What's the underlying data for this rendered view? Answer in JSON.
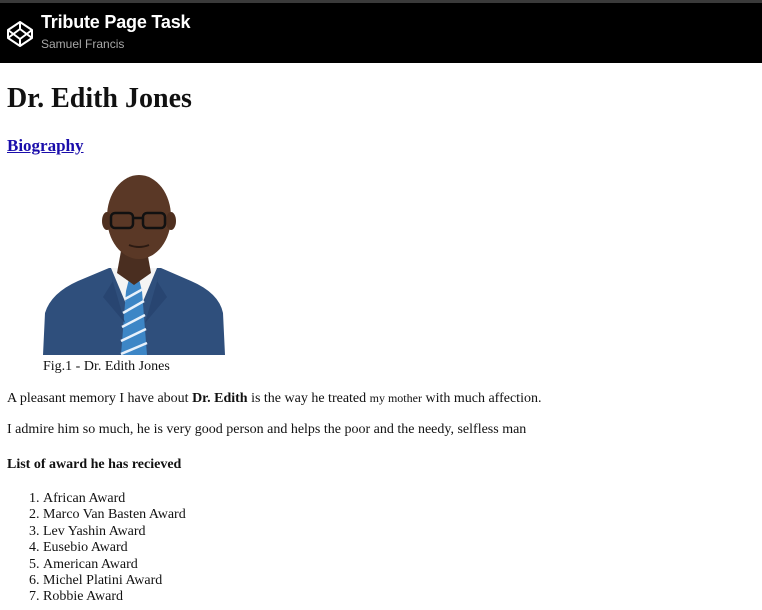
{
  "header": {
    "title": "Tribute Page Task",
    "author": "Samuel Francis",
    "logo_icon": "codepen-icon"
  },
  "page": {
    "heading": "Dr. Edith Jones",
    "biography_link": "Biography",
    "figure_caption": "Fig.1 - Dr. Edith Jones",
    "p1": {
      "pre": "A pleasant memory I have about ",
      "bold": "Dr. Edith",
      "mid": " is the way he treated ",
      "small": "my mother",
      "post": " with much affection."
    },
    "p2": "I admire him so much, he is very good person and helps the poor and the needy, selfless man",
    "awards_heading": "List of award he has recieved",
    "awards": [
      "African Award",
      "Marco Van Basten Award",
      "Lev Yashin Award",
      "Eusebio Award",
      "American Award",
      "Michel Platini Award",
      "Robbie Award"
    ]
  },
  "colors": {
    "header_bg": "#000000",
    "link": "#1a0dab",
    "suit": "#2f4f7c"
  }
}
